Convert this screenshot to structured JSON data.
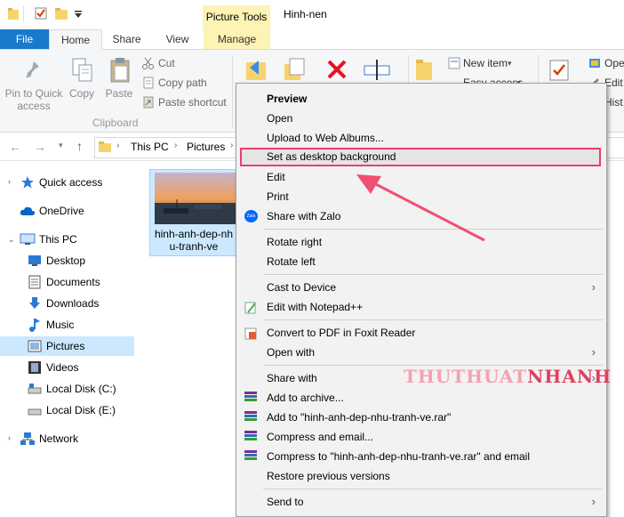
{
  "titlebar": {
    "picture_tools": "Picture Tools",
    "window_title": "Hinh-nen"
  },
  "tabs": {
    "file": "File",
    "home": "Home",
    "share": "Share",
    "view": "View",
    "manage": "Manage"
  },
  "ribbon": {
    "pin_label": "Pin to Quick access",
    "copy_label": "Copy",
    "paste_label": "Paste",
    "cut_label": "Cut",
    "copy_path_label": "Copy path",
    "paste_shortcut_label": "Paste shortcut",
    "clipboard_group": "Clipboard",
    "new_item_label": "New item",
    "easy_access_label": "Easy access",
    "open_label": "Ope",
    "edit_label": "Edit",
    "history_label": "Hist"
  },
  "address": {
    "crumbs": [
      "This PC",
      "Pictures"
    ]
  },
  "nav": {
    "quick_access": "Quick access",
    "onedrive": "OneDrive",
    "this_pc": "This PC",
    "items": [
      "Desktop",
      "Documents",
      "Downloads",
      "Music",
      "Pictures",
      "Videos",
      "Local Disk (C:)",
      "Local Disk (E:)"
    ],
    "network": "Network"
  },
  "file": {
    "name_line1": "hinh-anh-dep-nh",
    "name_line2": "u-tranh-ve"
  },
  "context_menu": {
    "preview": "Preview",
    "open": "Open",
    "upload": "Upload to Web Albums...",
    "set_desktop_bg": "Set as desktop background",
    "edit": "Edit",
    "print": "Print",
    "share_zalo": "Share with Zalo",
    "zalo_icon_text": "Zalo",
    "rotate_right": "Rotate right",
    "rotate_left": "Rotate left",
    "cast_to_device": "Cast to Device",
    "edit_npp": "Edit with Notepad++",
    "convert_pdf": "Convert to PDF in Foxit Reader",
    "open_with": "Open with",
    "share_with": "Share with",
    "add_archive": "Add to archive...",
    "add_rar": "Add to \"hinh-anh-dep-nhu-tranh-ve.rar\"",
    "compress_email": "Compress and email...",
    "compress_rar_email": "Compress to \"hinh-anh-dep-nhu-tranh-ve.rar\" and email",
    "restore": "Restore previous versions",
    "send_to": "Send to"
  },
  "watermark": {
    "part1": "THUTHUAT",
    "part2": "NHANH"
  },
  "colors": {
    "accent": "#1979ca",
    "highlight_border": "#e8406a",
    "manage_bg": "#fcf3b4",
    "selection": "#cce8ff"
  }
}
